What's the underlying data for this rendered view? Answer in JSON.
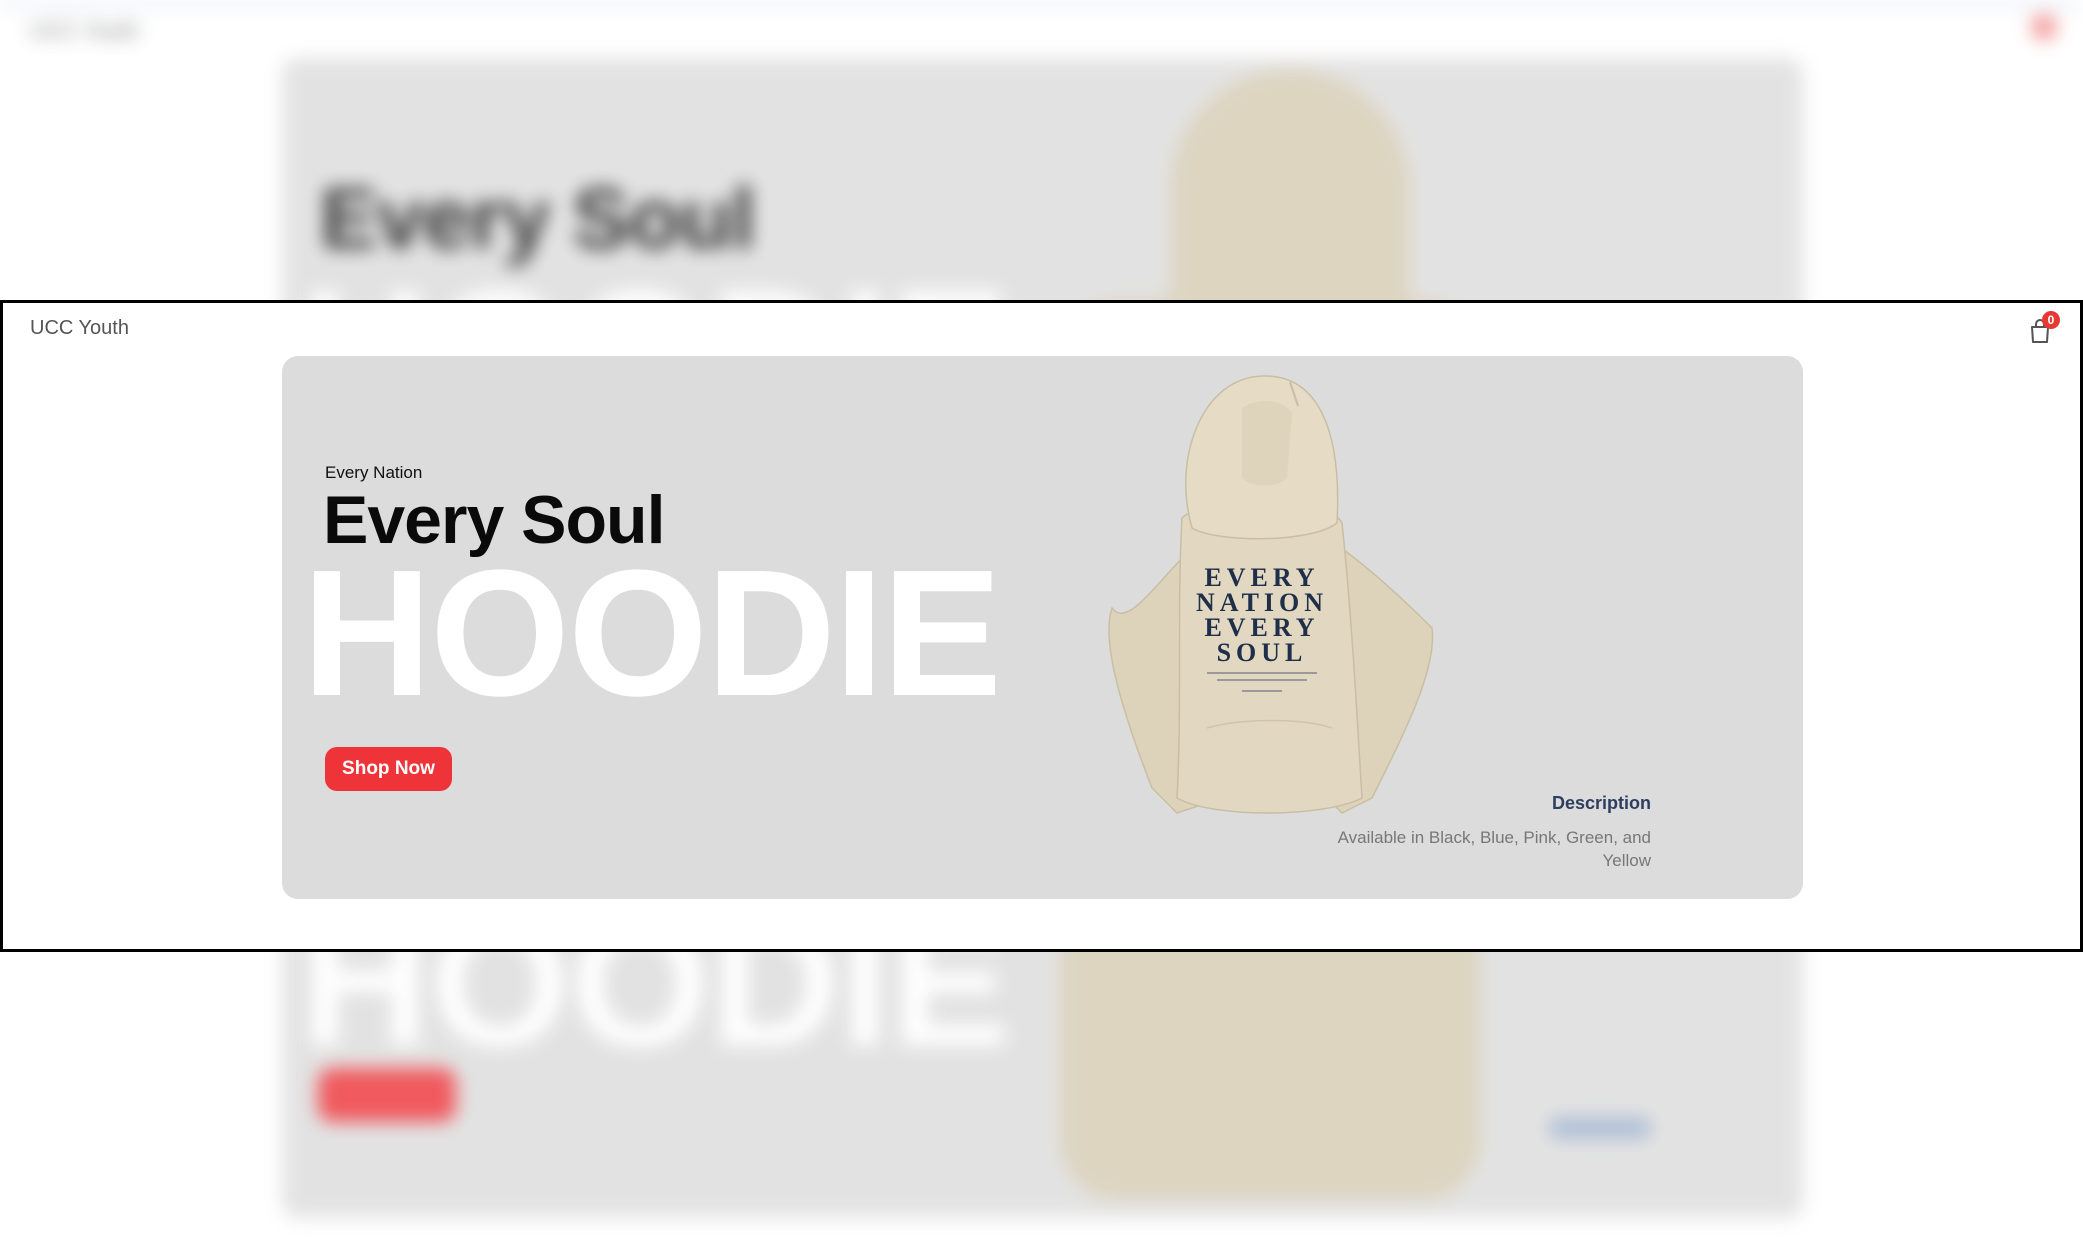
{
  "header": {
    "brand": "UCC Youth",
    "cart_count": "0",
    "cart_icon": "shopping-bag-icon"
  },
  "hero": {
    "kicker": "Every Nation",
    "headline": "Every Soul",
    "giant": "HOODIE",
    "cta_label": "Shop Now",
    "product_print": {
      "line1": "EVERY",
      "line2": "NATION",
      "line3": "EVERY",
      "line4": "SOUL"
    },
    "description_title": "Description",
    "description_text": "Available in Black, Blue, Pink, Green, and Yellow"
  },
  "colors": {
    "accent": "#ee3339",
    "hero_bg": "#dcdcdc",
    "hoodie": "#e2d8c2",
    "print": "#1f2f4a",
    "description_title": "#2d3e5e"
  }
}
